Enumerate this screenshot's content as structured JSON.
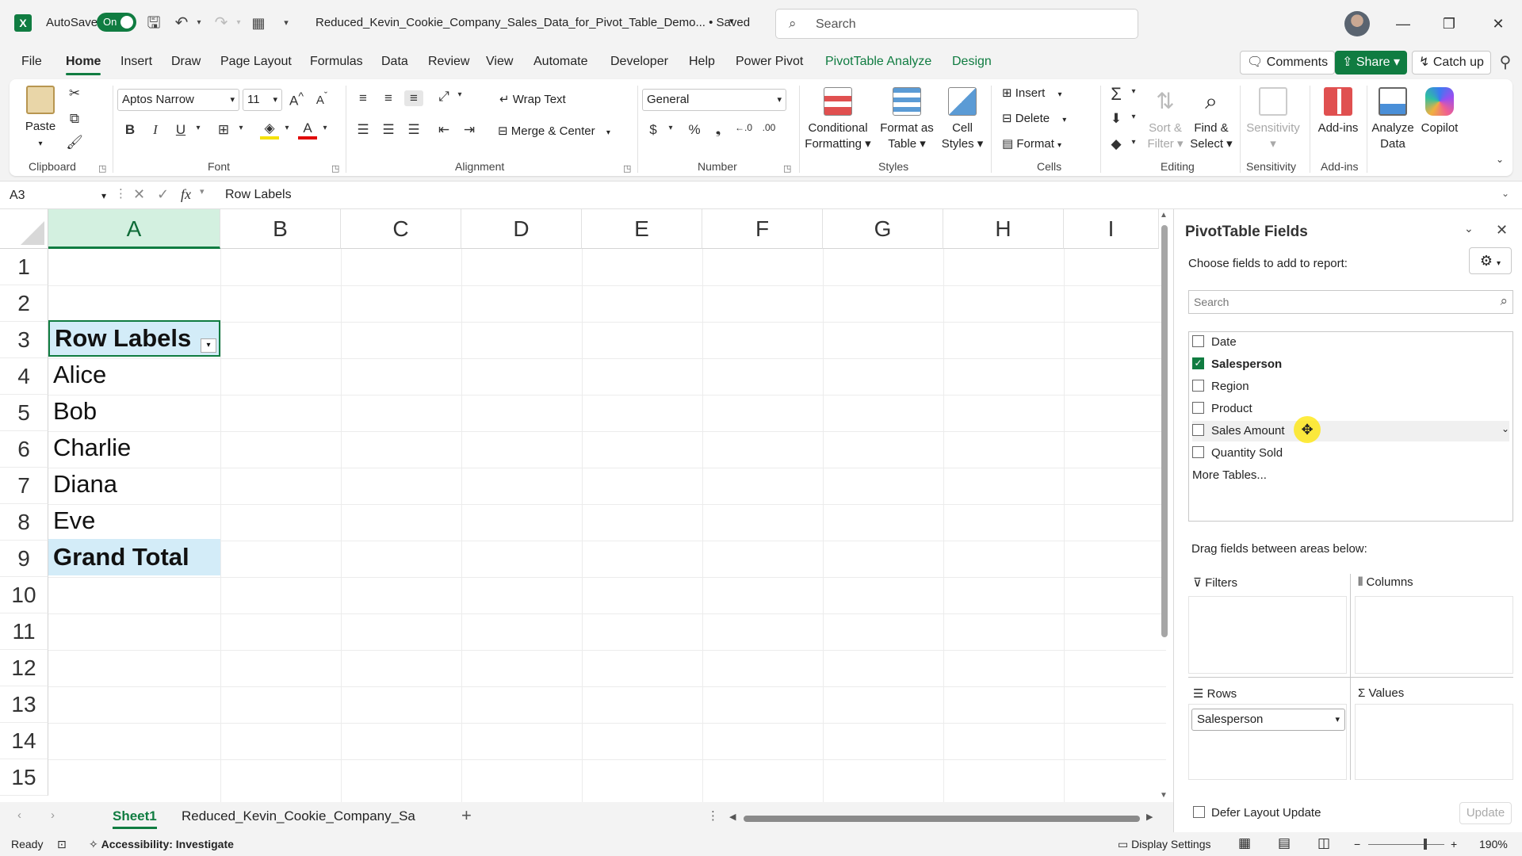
{
  "titlebar": {
    "autosave_label": "AutoSave",
    "autosave_state": "On",
    "filename": "Reduced_Kevin_Cookie_Company_Sales_Data_for_Pivot_Table_Demo... • Saved",
    "search_placeholder": "Search",
    "logo_letter": "X"
  },
  "tabs": [
    "File",
    "Home",
    "Insert",
    "Draw",
    "Page Layout",
    "Formulas",
    "Data",
    "Review",
    "View",
    "Automate",
    "Developer",
    "Help",
    "Power Pivot",
    "PivotTable Analyze",
    "Design"
  ],
  "active_tab": "Home",
  "header_buttons": {
    "comments": "Comments",
    "share": "Share",
    "catchup": "Catch up"
  },
  "ribbon": {
    "clipboard": {
      "paste": "Paste",
      "label": "Clipboard"
    },
    "font": {
      "name": "Aptos Narrow",
      "size": "11",
      "label": "Font",
      "bold": "B",
      "italic": "I",
      "underline": "U"
    },
    "alignment": {
      "wrap": "Wrap Text",
      "merge": "Merge & Center",
      "label": "Alignment"
    },
    "number": {
      "format": "General",
      "label": "Number"
    },
    "styles": {
      "conditional": "Conditional Formatting",
      "format_table": "Format as Table",
      "cell_styles": "Cell Styles",
      "label": "Styles"
    },
    "cells": {
      "insert": "Insert",
      "delete": "Delete",
      "format": "Format",
      "label": "Cells"
    },
    "editing": {
      "sort": "Sort & Filter",
      "find": "Find & Select",
      "label": "Editing"
    },
    "sensitivity": {
      "btn": "Sensitivity",
      "label": "Sensitivity"
    },
    "addins": {
      "btn": "Add-ins",
      "label": "Add-ins"
    },
    "analyze": {
      "btn": "Analyze Data"
    },
    "copilot": {
      "btn": "Copilot"
    }
  },
  "formula_bar": {
    "name_box": "A3",
    "value": "Row Labels"
  },
  "grid": {
    "columns": [
      "A",
      "B",
      "C",
      "D",
      "E",
      "F",
      "G",
      "H",
      "I"
    ],
    "rows": [
      "1",
      "2",
      "3",
      "4",
      "5",
      "6",
      "7",
      "8",
      "9",
      "10",
      "11",
      "12",
      "13",
      "14",
      "15"
    ],
    "cells": {
      "a3": "Row Labels",
      "a4": "Alice",
      "a5": "Bob",
      "a6": "Charlie",
      "a7": "Diana",
      "a8": "Eve",
      "a9": "Grand Total"
    }
  },
  "sheets": [
    "Sheet1",
    "Reduced_Kevin_Cookie_Company_Sa"
  ],
  "statusbar": {
    "ready": "Ready",
    "accessibility": "Accessibility: Investigate",
    "display": "Display Settings",
    "zoom": "190%"
  },
  "pivot": {
    "title": "PivotTable Fields",
    "choose": "Choose fields to add to report:",
    "search_placeholder": "Search",
    "fields": [
      {
        "label": "Date",
        "checked": false
      },
      {
        "label": "Salesperson",
        "checked": true
      },
      {
        "label": "Region",
        "checked": false
      },
      {
        "label": "Product",
        "checked": false
      },
      {
        "label": "Sales Amount",
        "checked": false
      },
      {
        "label": "Quantity Sold",
        "checked": false
      }
    ],
    "more_tables": "More Tables...",
    "drag_label": "Drag fields between areas below:",
    "areas": {
      "filters": "Filters",
      "columns": "Columns",
      "rows": "Rows",
      "values": "Values"
    },
    "rows_field": "Salesperson",
    "defer": "Defer Layout Update",
    "update": "Update"
  },
  "colors": {
    "accent": "#107c41",
    "pivot_fill": "#d3ecf8"
  }
}
